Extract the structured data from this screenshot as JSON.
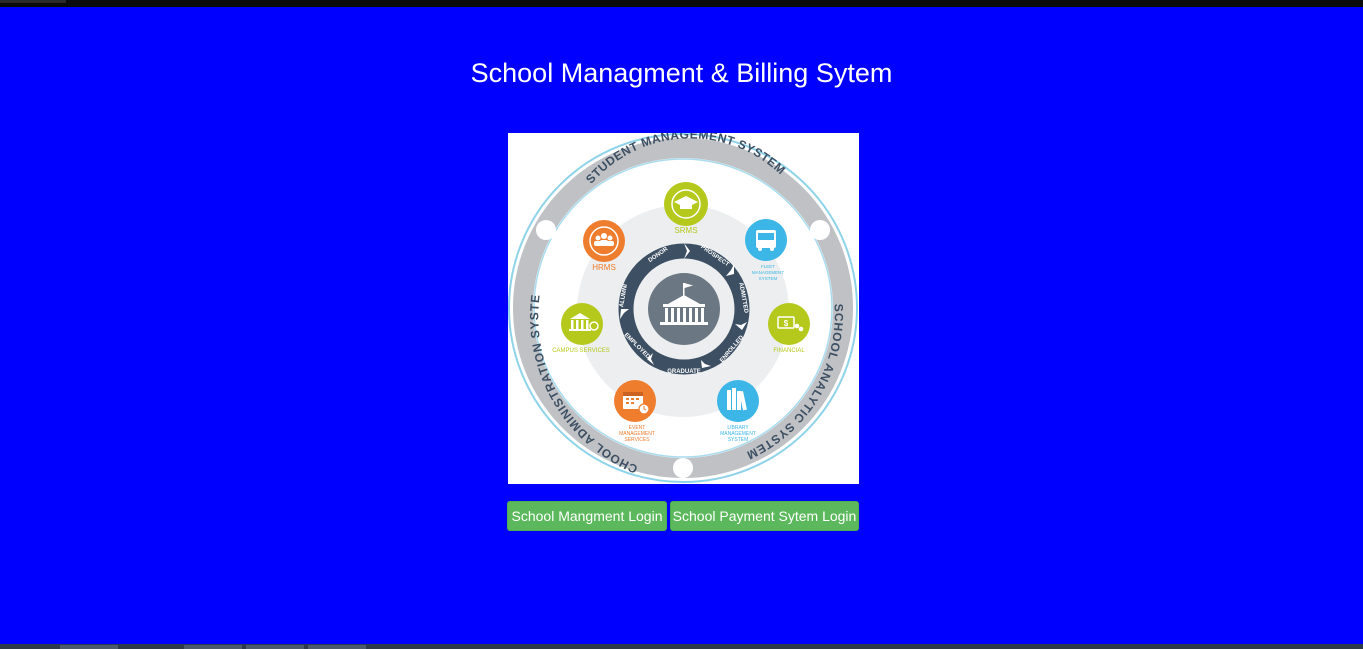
{
  "page": {
    "title": "School Managment & Billing Sytem"
  },
  "diagram": {
    "ring_top": "STUDENT MANAGEMENT SYSTEM",
    "ring_left": "SCHOOL ADMINISTRATION SYSTEM",
    "ring_right": "SCHOOL ANALYTIC SYSTEM",
    "modules": {
      "srms": "SRMS",
      "hrms": "HRMS",
      "fleet": [
        "FLEET",
        "MANAGEMENT",
        "SYSTEM"
      ],
      "campus": "CAMPUS SERVICES",
      "financial": "FINANCIAL",
      "event": [
        "EVENT",
        "MANAGEMENT",
        "SERVICES"
      ],
      "library": [
        "LIBRARY",
        "MANAGEMENT",
        "SYSTEM"
      ]
    },
    "cycle": [
      "DONOR",
      "PROSPECT",
      "ADMITTED",
      "ENROLLED",
      "GRADUATE",
      "EMPLOYED",
      "ALUMNI"
    ]
  },
  "buttons": {
    "school_login": "School Mangment Login",
    "payment_login": "School Payment Sytem Login"
  },
  "colors": {
    "background": "#0000ff",
    "button": "#5cb85c",
    "lime": "#b5c81c",
    "orange": "#ef7d2e",
    "cyan": "#3bb6e6",
    "navy": "#3d4f63"
  }
}
